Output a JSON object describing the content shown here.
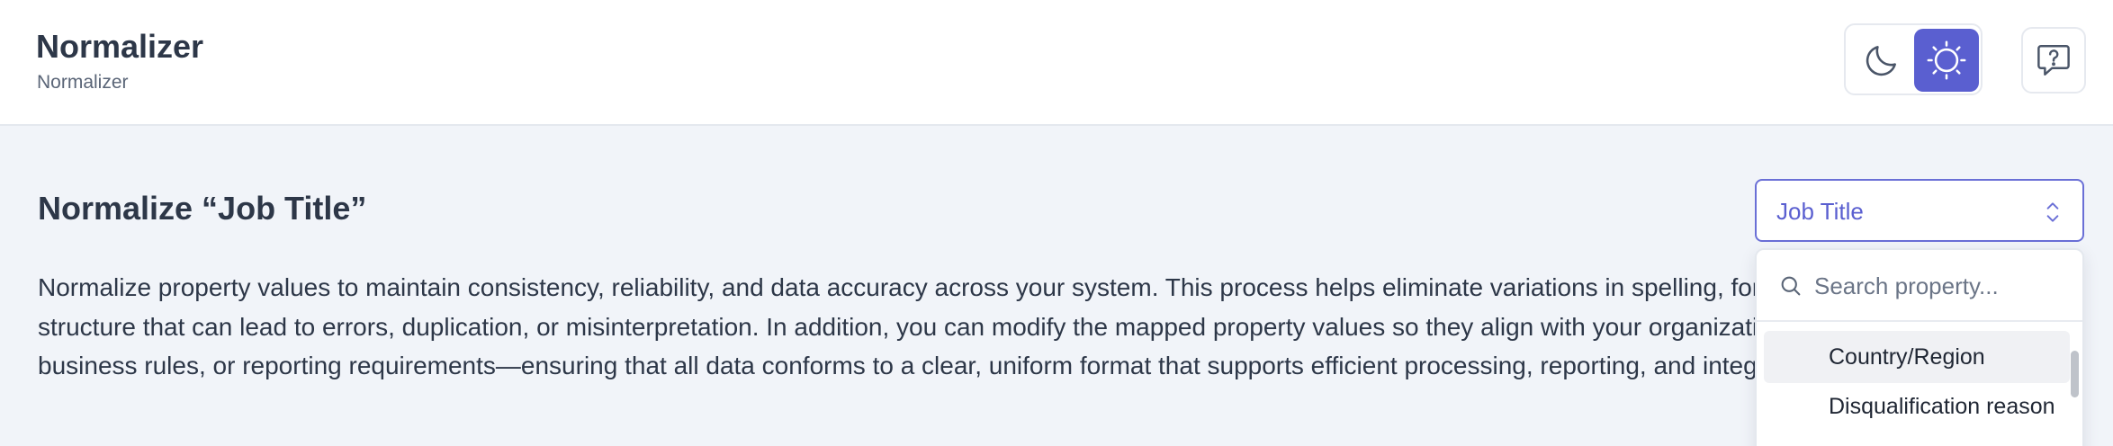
{
  "header": {
    "title": "Normalizer",
    "subtitle": "Normalizer",
    "theme_toggle": {
      "dark_icon": "moon-icon",
      "light_icon": "sun-icon",
      "active": "light"
    },
    "help_icon": "help-chat-icon"
  },
  "main": {
    "title": "Normalize “Job Title”",
    "description": "Normalize property values to maintain consistency, reliability, and data accuracy across your system. This process helps eliminate variations in spelling, formatting, units, or structure that can lead to errors, duplication, or misinterpretation. In addition, you can modify the mapped property values so they align with your organization’s naming conventions, business rules, or reporting requirements—ensuring that all data conforms to a clear, uniform format that supports efficient processing, reporting, and integration."
  },
  "property_select": {
    "value": "Job Title",
    "search_placeholder": "Search property...",
    "options": [
      {
        "label": "Country/Region"
      },
      {
        "label": "Disqualification reason"
      }
    ]
  },
  "colors": {
    "accent": "#5a5fd0",
    "background": "#f1f4f9",
    "text": "#2d3748"
  }
}
